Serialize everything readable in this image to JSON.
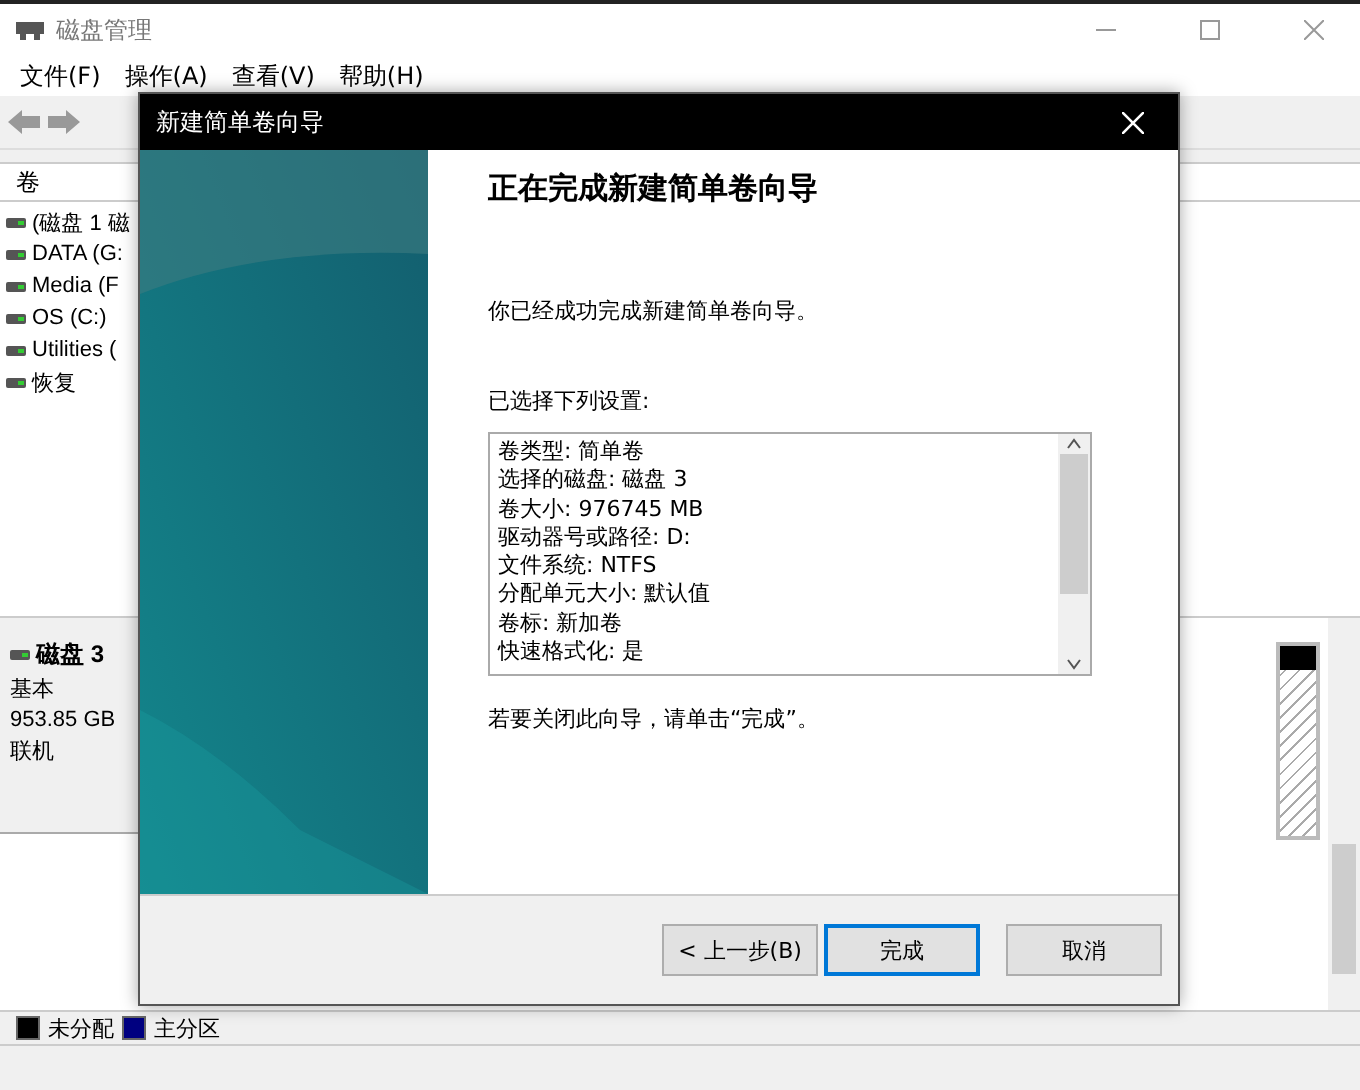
{
  "window": {
    "title": "磁盘管理"
  },
  "menu": [
    "文件(F)",
    "操作(A)",
    "查看(V)",
    "帮助(H)"
  ],
  "volume_list": {
    "columns": [
      "卷"
    ],
    "rows": [
      "(磁盘 1 磁",
      "DATA (G:",
      "Media (F",
      "OS (C:)",
      "Utilities (",
      "恢复"
    ]
  },
  "disk": {
    "name": "磁盘 3",
    "type": "基本",
    "size": "953.85 GB",
    "status": "联机"
  },
  "legend": [
    {
      "label": "未分配",
      "color": "#000000"
    },
    {
      "label": "主分区",
      "color": "#000080"
    }
  ],
  "dialog": {
    "title": "新建简单卷向导",
    "heading": "正在完成新建简单卷向导",
    "message": "你已经成功完成新建简单卷向导。",
    "settings_label": "已选择下列设置:",
    "settings": [
      "卷类型: 简单卷",
      "选择的磁盘: 磁盘 3",
      "卷大小: 976745 MB",
      "驱动器号或路径: D:",
      "文件系统: NTFS",
      "分配单元大小: 默认值",
      "卷标: 新加卷",
      "快速格式化: 是"
    ],
    "footer": "若要关闭此向导，请单击“完成”。",
    "buttons": [
      {
        "label": "< 上一步(B)",
        "default": false
      },
      {
        "label": "完成",
        "default": true
      },
      {
        "label": "取消",
        "default": false
      }
    ]
  }
}
